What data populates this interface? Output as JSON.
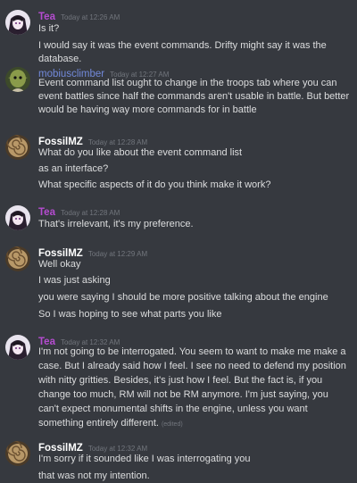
{
  "users": {
    "tea": {
      "name": "Tea",
      "color": "#b54cd0"
    },
    "mobius": {
      "name": "mobiusclimber",
      "color": "#7289da"
    },
    "fossil": {
      "name": "FossilMZ",
      "color": "#ffffff"
    }
  },
  "messages": [
    {
      "author": "Tea",
      "timestamp": "Today at 12:26 AM",
      "lines": [
        "Is it?",
        "I would say it was the event commands. Drifty might say it was the database."
      ]
    },
    {
      "author": "mobiusclimber",
      "timestamp": "Today at 12:27 AM",
      "lines": [
        "Event command list ought to change in the troops tab where you can event battles since half the commands aren't usable in battle. But better would be having way more commands for in battle"
      ]
    },
    {
      "author": "FossilMZ",
      "timestamp": "Today at 12:28 AM",
      "lines": [
        "What do you like about the event command list",
        "as an interface?",
        "What specific aspects of it do you think make it work?"
      ]
    },
    {
      "author": "Tea",
      "timestamp": "Today at 12:28 AM",
      "lines": [
        "That's irrelevant, it's my preference."
      ]
    },
    {
      "author": "FossilMZ",
      "timestamp": "Today at 12:29 AM",
      "lines": [
        "Well okay",
        "I was just asking",
        "you were saying I should be more positive talking about the engine",
        "So I was hoping to see what parts you like"
      ]
    },
    {
      "author": "Tea",
      "timestamp": "Today at 12:32 AM",
      "lines": [
        "I'm not going to be interrogated. You seem to want to make me make a case. But I already said how I feel. I see no need to defend my position with nitty gritties. Besides, it's just how I feel. But the fact is, if you change too much, RM will not be RM anymore. I'm just saying, you can't expect monumental shifts in the engine, unless you want something entirely different."
      ],
      "edited": "(edited)"
    },
    {
      "author": "FossilMZ",
      "timestamp": "Today at 12:32 AM",
      "lines": [
        "I'm sorry if it sounded like I was interrogating you",
        "that was not my intention."
      ]
    }
  ]
}
